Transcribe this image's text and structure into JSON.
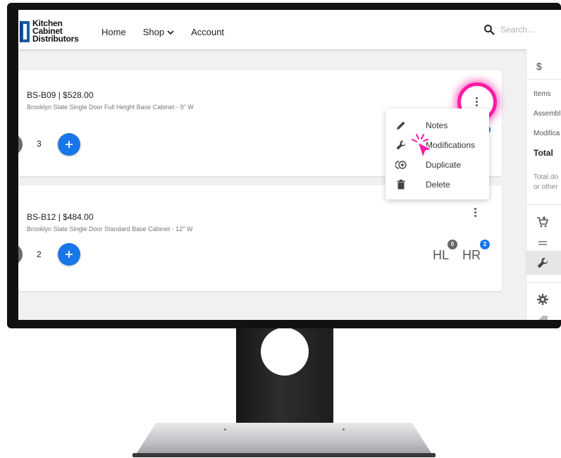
{
  "header": {
    "logo_lines": [
      "Kitchen",
      "Cabinet",
      "Distributors"
    ],
    "nav": [
      "Home",
      "Shop",
      "Account"
    ],
    "search_placeholder": "Search..."
  },
  "cart": {
    "items": [
      {
        "sku_price": "BS-B09 | $528.00",
        "description": "Brooklyn Slate Single Door Full Height Base Cabinet - 9\" W",
        "quantity": "3"
      },
      {
        "sku_price": "BS-B12 | $484.00",
        "description": "Brooklyn Slate Single Door Standard Base Cabinet - 12\" W",
        "quantity": "2",
        "hinge_left_label": "HL",
        "hinge_left_count": "0",
        "hinge_right_label": "HR",
        "hinge_right_count": "2"
      }
    ]
  },
  "menu": {
    "items": [
      {
        "label": "Notes",
        "icon": "pencil-icon"
      },
      {
        "label": "Modifications",
        "icon": "wrench-icon"
      },
      {
        "label": "Duplicate",
        "icon": "duplicate-icon"
      },
      {
        "label": "Delete",
        "icon": "trash-icon"
      }
    ]
  },
  "side_panel": {
    "currency_symbol": "$",
    "lines": [
      "Items",
      "Assembl",
      "Modifica"
    ],
    "total_label": "Total",
    "note_lines": [
      "Total do",
      "or other"
    ]
  },
  "colors": {
    "accent_blue": "#1976e8",
    "highlight_pink": "#ff1aa6",
    "logo_blue": "#1a5aa8"
  }
}
